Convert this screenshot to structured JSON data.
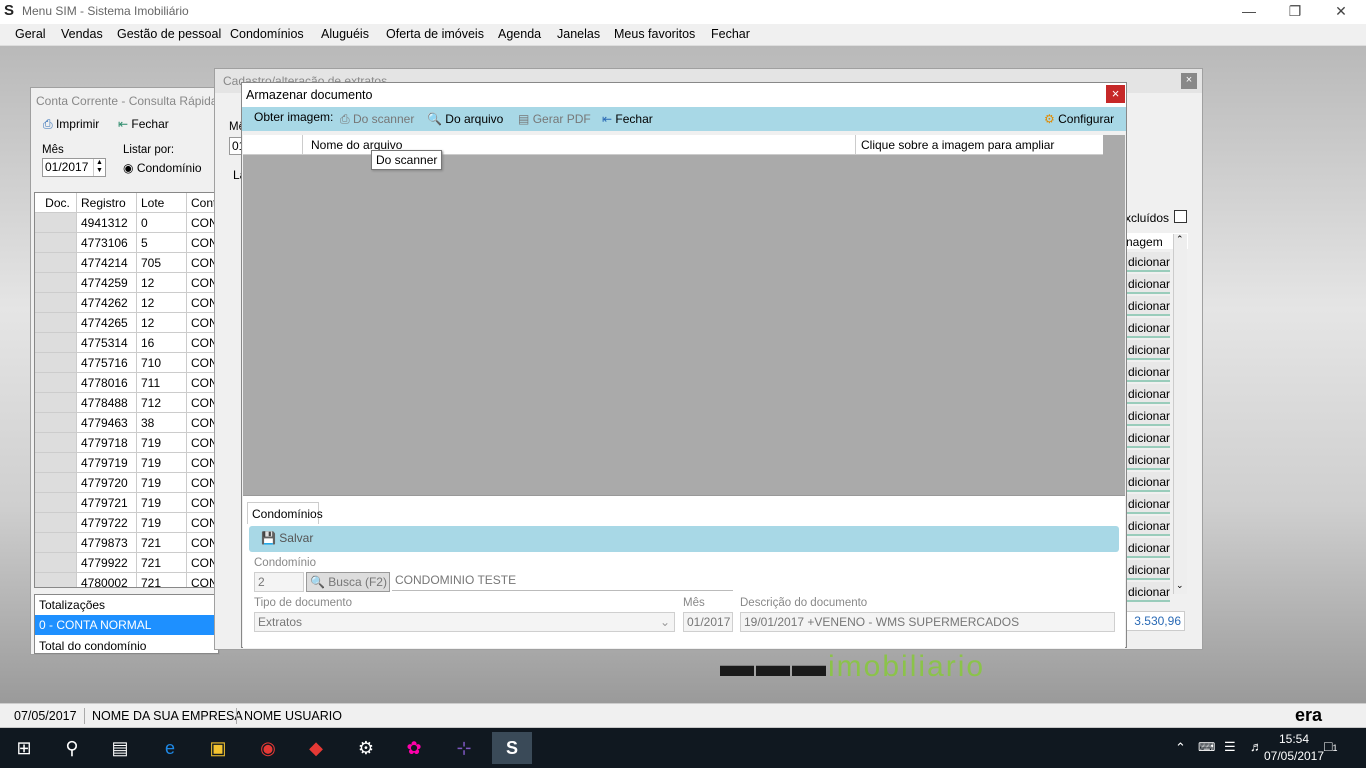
{
  "app": {
    "title": "Menu SIM - Sistema Imobiliário",
    "logo": "S"
  },
  "menu": [
    "Geral",
    "Vendas",
    "Gestão de pessoal",
    "Condomínios",
    "Aluguéis",
    "Oferta de imóveis",
    "Agenda",
    "Janelas",
    "Meus favoritos",
    "Fechar"
  ],
  "conta": {
    "title": "Conta Corrente - Consulta Rápida",
    "print": "Imprimir",
    "close": "Fechar",
    "mes_label": "Mês",
    "mes_value": "01/2017",
    "listar_label": "Listar por:",
    "listar_option": "Condomínio",
    "columns": [
      "Doc.",
      "Registro",
      "Lote",
      "Cont"
    ],
    "rows": [
      {
        "registro": "4941312",
        "lote": "0",
        "cont": "CONT"
      },
      {
        "registro": "4773106",
        "lote": "5",
        "cont": "CONT"
      },
      {
        "registro": "4774214",
        "lote": "705",
        "cont": "CONT"
      },
      {
        "registro": "4774259",
        "lote": "12",
        "cont": "CONT"
      },
      {
        "registro": "4774262",
        "lote": "12",
        "cont": "CONT"
      },
      {
        "registro": "4774265",
        "lote": "12",
        "cont": "CONT"
      },
      {
        "registro": "4775314",
        "lote": "16",
        "cont": "CONT"
      },
      {
        "registro": "4775716",
        "lote": "710",
        "cont": "CONT"
      },
      {
        "registro": "4778016",
        "lote": "711",
        "cont": "CONT"
      },
      {
        "registro": "4778488",
        "lote": "712",
        "cont": "CONT"
      },
      {
        "registro": "4779463",
        "lote": "38",
        "cont": "CONT"
      },
      {
        "registro": "4779718",
        "lote": "719",
        "cont": "CONT"
      },
      {
        "registro": "4779719",
        "lote": "719",
        "cont": "CONT"
      },
      {
        "registro": "4779720",
        "lote": "719",
        "cont": "CONT"
      },
      {
        "registro": "4779721",
        "lote": "719",
        "cont": "CONT"
      },
      {
        "registro": "4779722",
        "lote": "719",
        "cont": "CONT"
      },
      {
        "registro": "4779873",
        "lote": "721",
        "cont": "CONT"
      },
      {
        "registro": "4779922",
        "lote": "721",
        "cont": "CONT"
      },
      {
        "registro": "4780002",
        "lote": "721",
        "cont": "CONT"
      }
    ],
    "totalizacoes": "Totalizações",
    "conta_normal": "0 - CONTA NORMAL",
    "total_condominio": "Total do condomínio"
  },
  "cadastro": {
    "title": "Cadastro/alteração de extratos",
    "mes_partial": "Mê",
    "mes_field_partial": "01",
    "tab_partial": "La",
    "excluidos": "xcluídos",
    "imagem_header": "nagem",
    "adicionar": "dicionar",
    "total": "3.530,96"
  },
  "dialog": {
    "title": "Armazenar documento",
    "close": "×",
    "toolbar": {
      "obter": "Obter imagem:",
      "scanner": "Do scanner",
      "arquivo": "Do arquivo",
      "gerar_pdf": "Gerar PDF",
      "fechar": "Fechar",
      "configurar": "Configurar"
    },
    "grid_cols": [
      "Nome do arquivo",
      "Clique sobre a imagem para ampliar"
    ],
    "tooltip": "Do scanner",
    "tab": "Condomínios",
    "salvar": "Salvar",
    "condominio_label": "Condomínio",
    "condominio_num": "2",
    "busca": "Busca (F2)",
    "condominio_nome": "CONDOMINIO TESTE",
    "tipo_label": "Tipo de documento",
    "tipo_value": "Extratos",
    "mes_label": "Mês",
    "mes_value": "01/2017",
    "desc_label": "Descrição do documento",
    "desc_value": "19/01/2017 +VENENO - WMS SUPERMERCADOS"
  },
  "status": {
    "date": "07/05/2017",
    "company": "NOME DA SUA EMPRESA",
    "user": "NOME USUARIO",
    "brand": "era"
  },
  "taskbar": {
    "time": "15:54",
    "date": "07/05/2017",
    "notif": "1"
  },
  "colors": {
    "toolbar": "#a8d8e6",
    "selected": "#1e90ff"
  }
}
